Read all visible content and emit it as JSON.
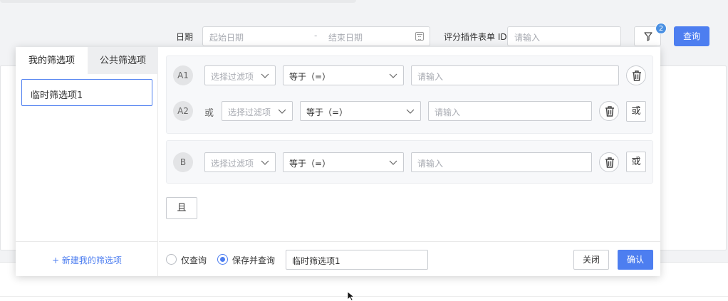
{
  "search": {
    "date_label": "日期",
    "start_placeholder": "起始日期",
    "date_separator": "-",
    "end_placeholder": "结束日期",
    "id_label": "评分插件表单 ID",
    "id_placeholder": "请输入",
    "filter_badge": "2",
    "query_label": "查询"
  },
  "popup": {
    "tabs": [
      "我的筛选项",
      "公共筛选项"
    ],
    "saved_filters": [
      "临时筛选项1"
    ],
    "new_filter_label": "+ 新建我的筛选项",
    "groups": [
      {
        "rows": [
          {
            "tag": "A1",
            "connector": "",
            "field_placeholder": "选择过滤项",
            "operator": "等于（=）",
            "value_placeholder": "请输入",
            "has_or_button": false
          },
          {
            "tag": "A2",
            "connector": "或",
            "field_placeholder": "选择过滤项",
            "operator": "等于（=）",
            "value_placeholder": "请输入",
            "has_or_button": true,
            "or_label": "或"
          }
        ]
      },
      {
        "rows": [
          {
            "tag": "B",
            "connector": "",
            "field_placeholder": "选择过滤项",
            "operator": "等于（=）",
            "value_placeholder": "请输入",
            "has_or_button": true,
            "or_label": "或"
          }
        ]
      }
    ],
    "and_label": "且",
    "footer": {
      "radio_query_only": "仅查询",
      "radio_save_query": "保存并查询",
      "selected_radio": "保存并查询",
      "filter_name_value": "临时筛选项1",
      "close_label": "关闭",
      "confirm_label": "确认"
    }
  },
  "colors": {
    "accent": "#4d7ef0",
    "badge": "#4a90e2"
  },
  "icons": [
    "calendar-icon",
    "filter-icon",
    "chevron-down-icon",
    "trash-icon",
    "cursor-icon"
  ]
}
